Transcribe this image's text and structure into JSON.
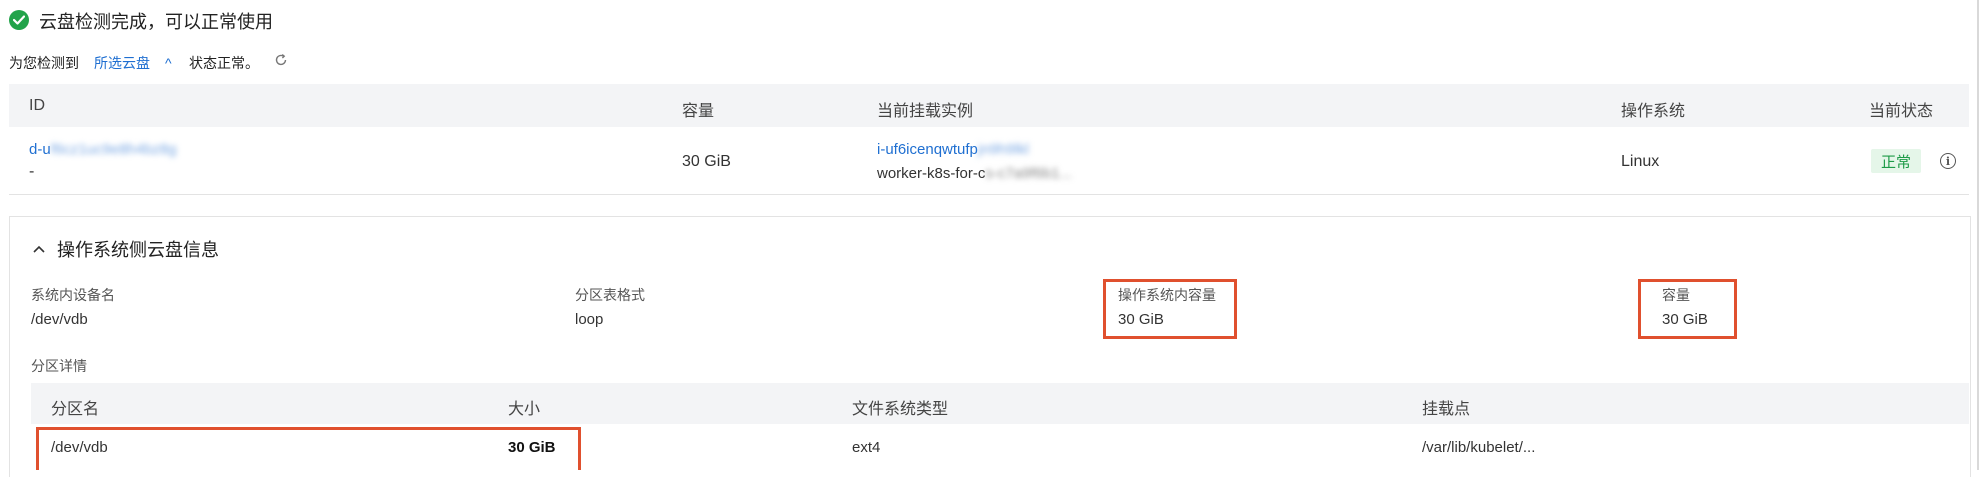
{
  "status": {
    "title": "云盘检测完成，可以正常使用"
  },
  "detect_line": {
    "prefix": "为您检测到",
    "link": "所选云盘",
    "chevron": "^",
    "suffix": "状态正常。"
  },
  "disk_table": {
    "headers": {
      "id": "ID",
      "capacity": "容量",
      "instance": "当前挂载实例",
      "os": "操作系统",
      "state": "当前状态"
    },
    "row": {
      "id": "d-u",
      "id_blurred": "f6cz1uc9e8h4bz8g",
      "id_sub": "-",
      "capacity": "30 GiB",
      "instance": "i-uf6icenqwtufp",
      "instance_blurred": "jn9h9lkl",
      "instance_name": "worker-k8s-for-c",
      "instance_name_blurred": "s-c7a9f6b1...",
      "os": "Linux",
      "state": "正常"
    }
  },
  "os_panel": {
    "title": "操作系统侧云盘信息",
    "fields": {
      "device_label": "系统内设备名",
      "device_value": "/dev/vdb",
      "partition_table_label": "分区表格式",
      "partition_table_value": "loop",
      "os_capacity_label": "操作系统内容量",
      "os_capacity_value": "30 GiB",
      "capacity_label": "容量",
      "capacity_value": "30 GiB"
    },
    "partition_title": "分区详情",
    "partition_headers": {
      "name": "分区名",
      "size": "大小",
      "fs": "文件系统类型",
      "mount": "挂载点"
    },
    "partition_row": {
      "name": "/dev/vdb",
      "size": "30 GiB",
      "fs": "ext4",
      "mount": "/var/lib/kubelet/..."
    }
  },
  "colors": {
    "accent": "#1f6fd1",
    "success": "#22a34a",
    "highlight": "#e0502e"
  }
}
